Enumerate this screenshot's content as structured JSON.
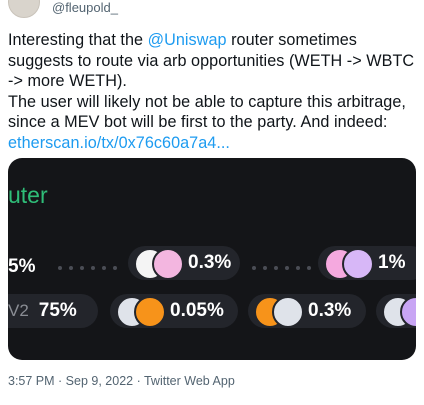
{
  "author": {
    "handle": "@fleupold_"
  },
  "tweet": {
    "line1_pre": "Interesting that the ",
    "mention": "@Uniswap",
    "line1_post": " router sometimes suggests to route via arb opportunities (WETH -> WBTC -> more WETH).",
    "line2": "The user will likely not be able to capture this arbitrage, since a MEV bot will be first to the party. And indeed: ",
    "link": "etherscan.io/tx/0x76c60a7a4..."
  },
  "media": {
    "title": "uter",
    "row1": {
      "left_pct": "5%",
      "pool1_pct": "0.3%",
      "pool2_pct": "1%"
    },
    "row2": {
      "version": "V2",
      "share": "75%",
      "pool1_pct": "0.05%",
      "pool2_pct": "0.3%"
    },
    "colors": {
      "accent_green": "#2fbd78",
      "background": "#141518",
      "pill": "#23252b"
    }
  },
  "meta": {
    "time": "3:57 PM",
    "sep1": " · ",
    "date": "Sep 9, 2022",
    "sep2": " · ",
    "client": "Twitter Web App"
  }
}
